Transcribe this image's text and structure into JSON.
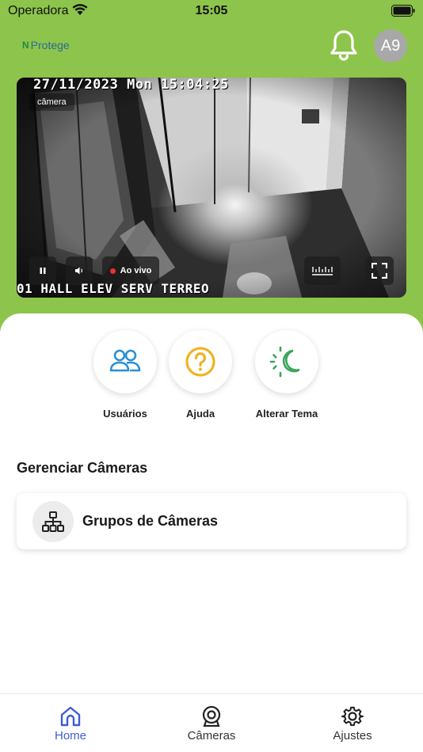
{
  "status_bar": {
    "carrier": "Operadora",
    "time": "15:05"
  },
  "header": {
    "brand": "Protege",
    "avatar_initials": "A9",
    "icons": [
      "bell-icon"
    ]
  },
  "video": {
    "timestamp": "27/11/2023 Mon 15:04:25",
    "camera_name": "01 HALL ELEV SERV TERREO",
    "tag": "câmera",
    "live_label": "Ao vivo",
    "live_color": "#e8342a"
  },
  "actions": [
    {
      "label": "Usuários",
      "icon": "users-icon",
      "color": "#2b8fd6"
    },
    {
      "label": "Ajuda",
      "icon": "help-icon",
      "color": "#f0b323"
    },
    {
      "label": "Alterar Tema",
      "icon": "theme-icon",
      "color": "#3aa55b"
    }
  ],
  "manage": {
    "title": "Gerenciar Câmeras",
    "items": [
      {
        "label": "Grupos de Câmeras",
        "icon": "hierarchy-icon"
      }
    ]
  },
  "nav": {
    "items": [
      {
        "label": "Home",
        "icon": "home-icon",
        "active": true
      },
      {
        "label": "Câmeras",
        "icon": "camera-icon",
        "active": false
      },
      {
        "label": "Ajustes",
        "icon": "gear-icon",
        "active": false
      }
    ],
    "active_color": "#3f5bd6"
  },
  "theme": {
    "header_bg": "#8dc44b"
  }
}
